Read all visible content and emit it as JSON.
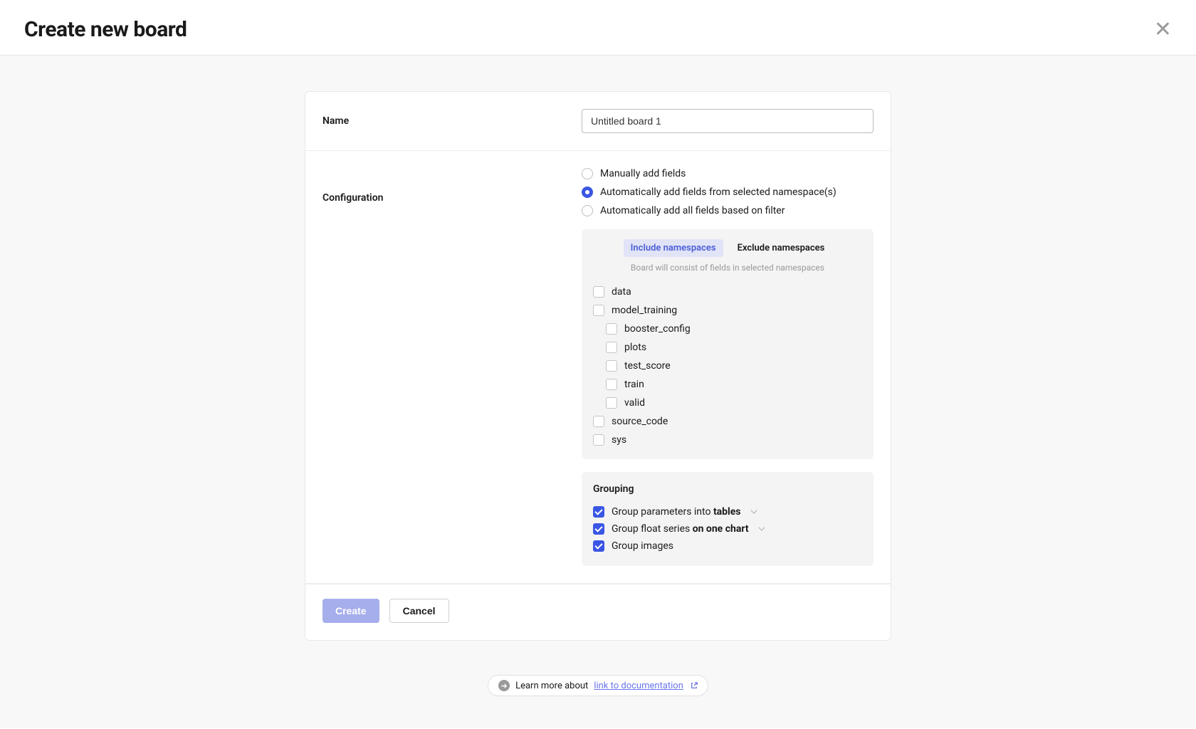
{
  "header": {
    "title": "Create new board"
  },
  "name": {
    "label": "Name",
    "value": "Untitled board 1"
  },
  "configuration": {
    "label": "Configuration",
    "options": {
      "manual": "Manually add fields",
      "auto_ns": "Automatically add fields from selected namespace(s)",
      "auto_filter": "Automatically add all fields based on filter"
    },
    "tabs": {
      "include": "Include namespaces",
      "exclude": "Exclude namespaces"
    },
    "hint": "Board will consist of fields in selected namespaces",
    "tree": {
      "data": "data",
      "model_training": "model_training",
      "booster_config": "booster_config",
      "plots": "plots",
      "test_score": "test_score",
      "train": "train",
      "valid": "valid",
      "source_code": "source_code",
      "sys": "sys"
    }
  },
  "grouping": {
    "title": "Grouping",
    "params_prefix": "Group parameters into ",
    "params_bold": "tables",
    "series_prefix": "Group float series ",
    "series_bold": "on one chart",
    "images": "Group images"
  },
  "buttons": {
    "create": "Create",
    "cancel": "Cancel"
  },
  "learn": {
    "prefix": "Learn more about",
    "link": "link to documentation"
  }
}
